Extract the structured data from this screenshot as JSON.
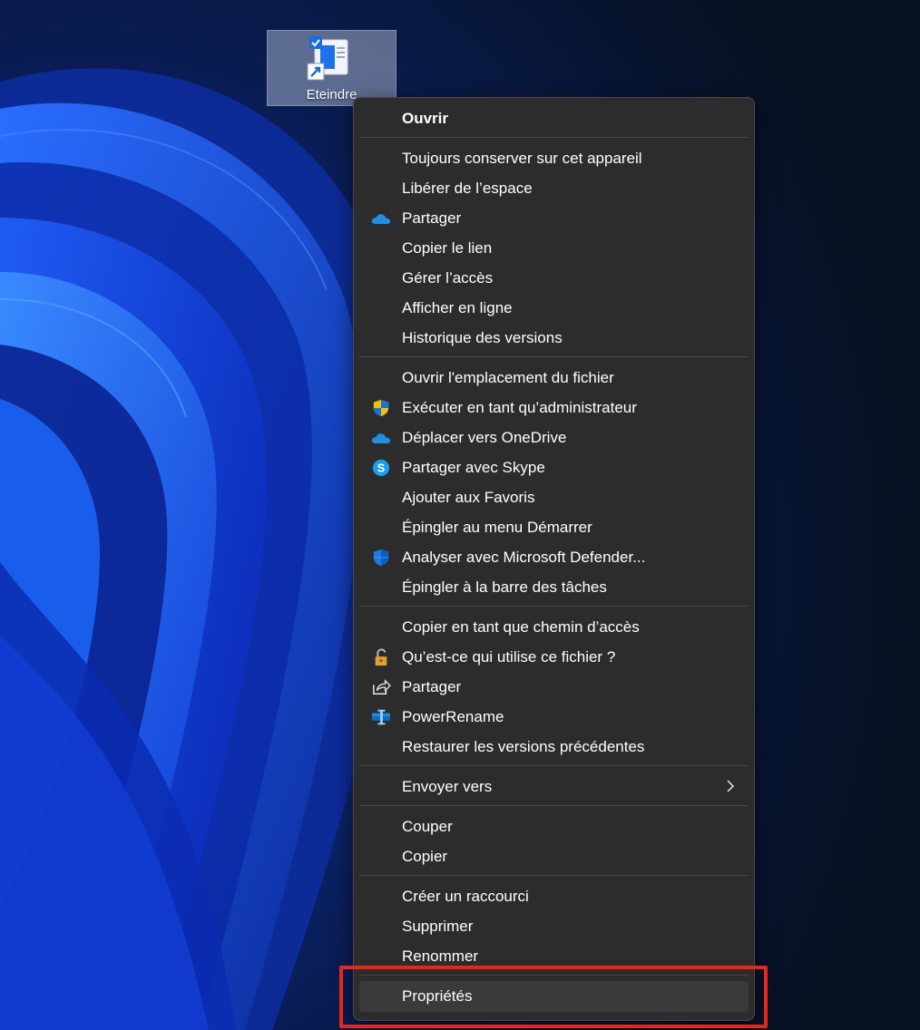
{
  "desktop": {
    "icon_label": "Eteindre"
  },
  "menu": {
    "open": "Ouvrir",
    "group1": [
      "Toujours conserver sur cet appareil",
      "Libérer de l’espace",
      "Partager",
      "Copier le lien",
      "Gérer l’accès",
      "Afficher en ligne",
      "Historique des versions"
    ],
    "group2": [
      "Ouvrir l'emplacement du fichier",
      "Exécuter en tant qu’administrateur",
      "Déplacer vers OneDrive",
      "Partager avec Skype",
      "Ajouter aux Favoris",
      "Épingler au menu Démarrer",
      "Analyser avec Microsoft Defender...",
      "Épingler à la barre des tâches"
    ],
    "group3": [
      "Copier en tant que chemin d’accès",
      "Qu’est-ce qui utilise ce fichier ?",
      "Partager",
      "PowerRename",
      "Restaurer les versions précédentes"
    ],
    "send_to": "Envoyer vers",
    "group5": [
      "Couper",
      "Copier"
    ],
    "group6": [
      "Créer un raccourci",
      "Supprimer",
      "Renommer"
    ],
    "properties": "Propriétés"
  },
  "colors": {
    "menu_bg": "#2c2c2c",
    "highlight": "#e8261a",
    "onedrive": "#1f8fe6"
  },
  "icons": {
    "onedrive": "cloud-icon",
    "uac": "shield-uac-icon",
    "skype": "skype-icon",
    "defender": "defender-shield-icon",
    "lock": "padlock-icon",
    "share": "share-arrow-icon",
    "powerrename": "power-rename-icon"
  }
}
